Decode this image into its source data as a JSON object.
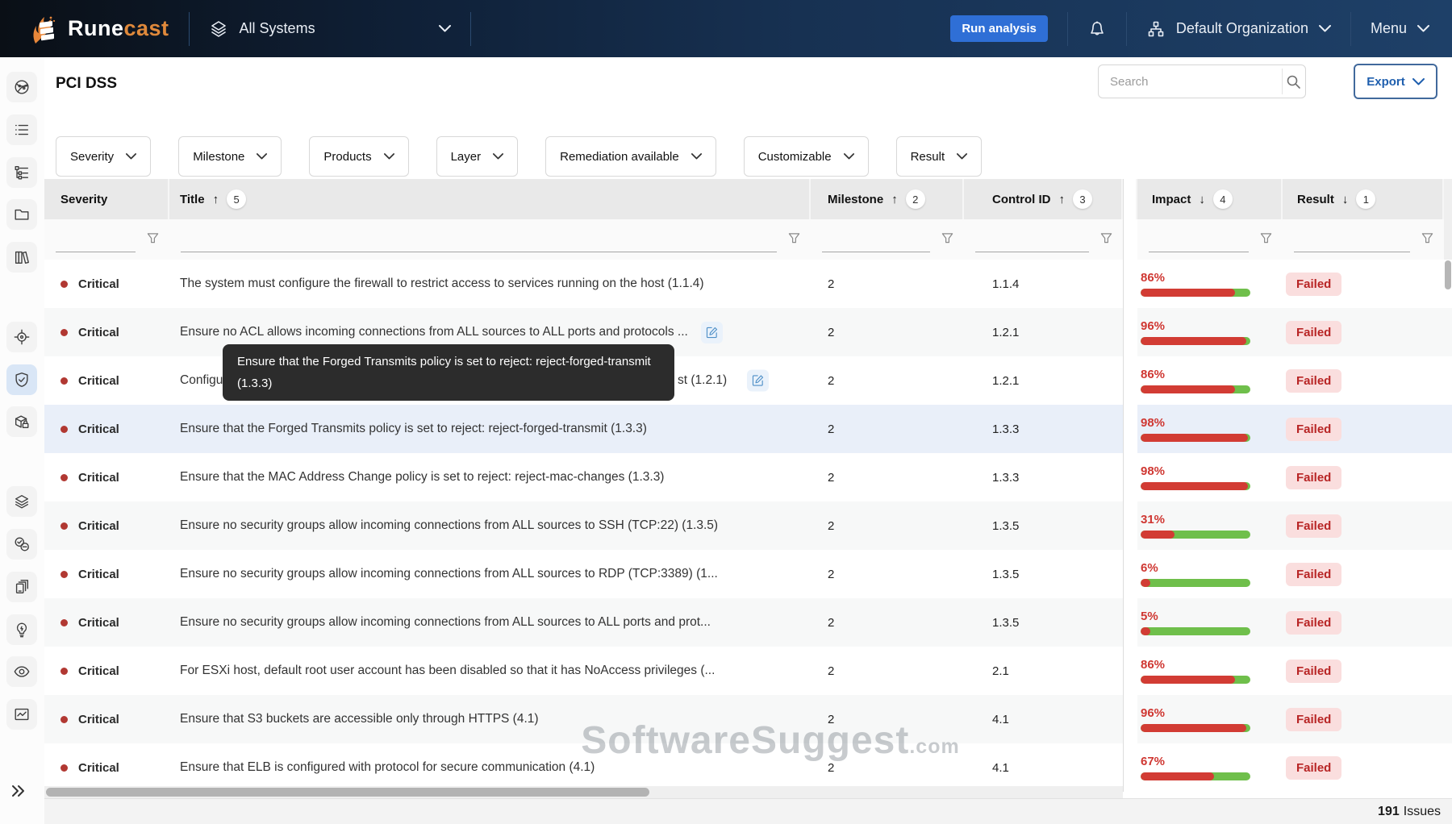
{
  "navbar": {
    "brand": {
      "primary": "Rune",
      "secondary": "cast"
    },
    "system_selector_label": "All Systems",
    "run_analysis_label": "Run analysis",
    "organization_label": "Default Organization",
    "menu_label": "Menu",
    "icons": [
      "runecast-flame-logo",
      "layers-icon",
      "chevron-down-icon",
      "bell-icon",
      "org-chart-icon"
    ]
  },
  "sidebar": {
    "icons": [
      "globe-network-icon",
      "list-icon",
      "tree-list-icon",
      "folder-icon",
      "library-icon",
      "target-icon",
      "shield-check-icon",
      "package-lock-icon",
      "layers-stack-icon",
      "status-checks-icon",
      "devices-icon",
      "lightbulb-icon",
      "eye-icon",
      "chart-frame-icon",
      "expand-sidebar-icon"
    ],
    "active_icon": "shield-check-icon"
  },
  "page": {
    "title": "PCI DSS",
    "search_placeholder": "Search",
    "export_label": "Export"
  },
  "filters": [
    {
      "label": "Severity"
    },
    {
      "label": "Milestone"
    },
    {
      "label": "Products"
    },
    {
      "label": "Layer"
    },
    {
      "label": "Remediation available"
    },
    {
      "label": "Customizable"
    },
    {
      "label": "Result"
    }
  ],
  "table": {
    "columns": [
      {
        "label": "Severity"
      },
      {
        "label": "Title",
        "sort_arrow": "↑",
        "sort_order": "5"
      },
      {
        "label": "Milestone",
        "sort_arrow": "↑",
        "sort_order": "2"
      },
      {
        "label": "Control ID",
        "sort_arrow": "↑",
        "sort_order": "3"
      },
      {
        "label": "Impact",
        "sort_arrow": "↓",
        "sort_order": "4"
      },
      {
        "label": "Result",
        "sort_arrow": "↓",
        "sort_order": "1"
      }
    ],
    "rows": [
      {
        "severity": "Critical",
        "title": "The system must configure the firewall to restrict access to services running on the host (1.1.4)",
        "milestone": "2",
        "control_id": "1.1.4",
        "impact_pct": 86,
        "result": "Failed"
      },
      {
        "severity": "Critical",
        "title": "Ensure no ACL allows incoming connections from ALL sources to ALL ports and protocols ...",
        "has_edit": true,
        "milestone": "2",
        "control_id": "1.2.1",
        "impact_pct": 96,
        "result": "Failed"
      },
      {
        "severity": "Critical",
        "title_parts": {
          "left": "Configu",
          "right": "st (1.2.1)"
        },
        "has_edit": true,
        "milestone": "2",
        "control_id": "1.2.1",
        "impact_pct": 86,
        "result": "Failed"
      },
      {
        "severity": "Critical",
        "title": "Ensure that the Forged Transmits policy is set to reject: reject-forged-transmit (1.3.3)",
        "highlighted": true,
        "milestone": "2",
        "control_id": "1.3.3",
        "impact_pct": 98,
        "result": "Failed"
      },
      {
        "severity": "Critical",
        "title": "Ensure that the MAC Address Change policy is set to reject: reject-mac-changes (1.3.3)",
        "milestone": "2",
        "control_id": "1.3.3",
        "impact_pct": 98,
        "result": "Failed"
      },
      {
        "severity": "Critical",
        "title": "Ensure no security groups allow incoming connections from ALL sources to SSH (TCP:22) (1.3.5)",
        "milestone": "2",
        "control_id": "1.3.5",
        "impact_pct": 31,
        "result": "Failed"
      },
      {
        "severity": "Critical",
        "title": "Ensure no security groups allow incoming connections from ALL sources to RDP (TCP:3389) (1...",
        "milestone": "2",
        "control_id": "1.3.5",
        "impact_pct": 6,
        "result": "Failed"
      },
      {
        "severity": "Critical",
        "title": "Ensure no security groups allow incoming connections from ALL sources to ALL ports and prot...",
        "milestone": "2",
        "control_id": "1.3.5",
        "impact_pct": 5,
        "result": "Failed"
      },
      {
        "severity": "Critical",
        "title": "For ESXi host, default root user account has been disabled so that it has NoAccess privileges (...",
        "milestone": "2",
        "control_id": "2.1",
        "impact_pct": 86,
        "result": "Failed"
      },
      {
        "severity": "Critical",
        "title": "Ensure that S3 buckets are accessible only through HTTPS (4.1)",
        "milestone": "2",
        "control_id": "4.1",
        "impact_pct": 96,
        "result": "Failed"
      },
      {
        "severity": "Critical",
        "title": "Ensure that ELB is configured with protocol for secure communication (4.1)",
        "milestone": "2",
        "control_id": "4.1",
        "impact_pct": 67,
        "result": "Failed"
      }
    ],
    "issues_count": "191",
    "issues_label": "Issues"
  },
  "tooltip": {
    "text": "Ensure that the Forged Transmits policy is set to reject: reject-forged-transmit (1.3.3)"
  },
  "watermark": {
    "main": "SoftwareSuggest",
    "suffix": ".com"
  },
  "colors": {
    "navbar_gradient_start": "#0a0f16",
    "navbar_gradient_end": "#1e4068",
    "brand_accent": "#e0893b",
    "primary_button": "#2f6fd6",
    "export_text": "#1f5fae",
    "critical_dot": "#b13832",
    "impact_red": "#d23c34",
    "impact_green": "#6fbf4b",
    "failed_badge_bg": "#fadede",
    "failed_badge_text": "#b82525",
    "row_highlight": "#e9eff9",
    "header_bg": "#e9e9e9"
  }
}
